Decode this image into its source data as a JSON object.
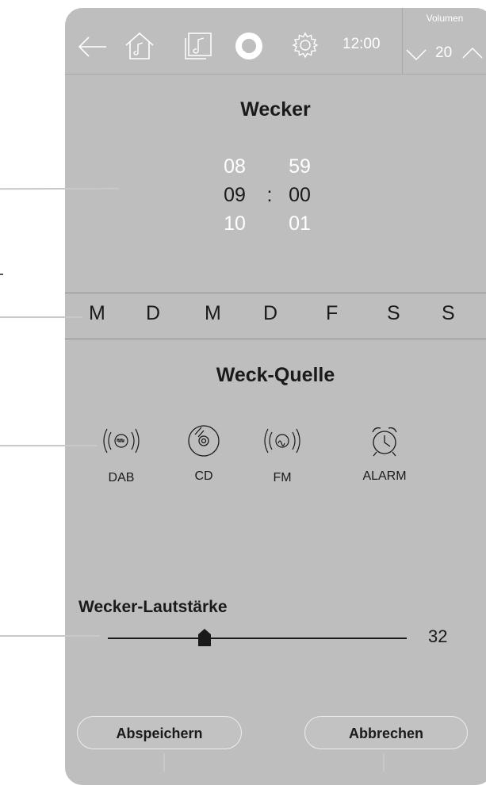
{
  "topbar": {
    "time": "12:00",
    "icons": [
      "back-arrow-icon",
      "home-music-icon",
      "music-library-icon",
      "alexa-icon",
      "settings-gear-icon"
    ],
    "volume_label": "Volumen",
    "volume_value": "20"
  },
  "alarm": {
    "title": "Wecker",
    "hours": {
      "prev": "08",
      "current": "09",
      "next": "10"
    },
    "separator": ":",
    "minutes": {
      "prev": "59",
      "current": "00",
      "next": "01"
    }
  },
  "weekdays": [
    "M",
    "D",
    "M",
    "D",
    "F",
    "S",
    "S"
  ],
  "source": {
    "title": "Weck-Quelle",
    "items": [
      {
        "label": "DAB",
        "icon": "dab-radio-icon"
      },
      {
        "label": "CD",
        "icon": "cd-icon"
      },
      {
        "label": "FM",
        "icon": "fm-radio-icon"
      },
      {
        "label": "ALARM",
        "icon": "alarm-clock-icon"
      }
    ]
  },
  "volume": {
    "title": "Wecker-Lautstärke",
    "value": "32"
  },
  "buttons": {
    "save": "Abspeichern",
    "cancel": "Abbrechen"
  },
  "colors": {
    "screen_bg": "#bfbebf",
    "text": "#1a1a1a",
    "dim_text": "#ffffff"
  }
}
